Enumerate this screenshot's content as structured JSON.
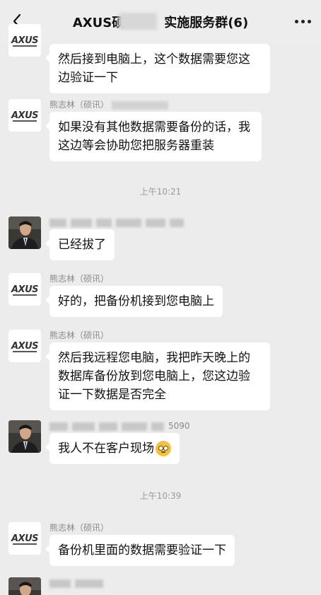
{
  "header": {
    "title_left": "AXUS硕",
    "title_right": "实施服务群(6)"
  },
  "messages": [
    {
      "text": "然后接到电脑上，这个数据需要您这边验证一下"
    },
    {
      "sender": "熊志林（硕讯）",
      "text": "如果没有其他数据需要备份的话，我这边等会协助您把服务器重装"
    },
    {
      "text": "已经拔了"
    },
    {
      "sender": "熊志林（硕讯）",
      "text": "好的，把备份机接到您电脑上"
    },
    {
      "sender": "熊志林（硕讯）",
      "text": "然后我远程您电脑，我把昨天晚上的数据库备份放到您电脑上，您这边验证一下数据是否完全"
    },
    {
      "sender_suffix": "5090",
      "text": "我人不在客户现场"
    },
    {
      "sender": "熊志林（硕讯）",
      "text": "备份机里面的数据需要验证一下"
    }
  ],
  "timestamps": [
    "上午10:21",
    "上午10:39"
  ],
  "avatar_logo": "AXUS",
  "colors": {
    "background": "#ececec",
    "bubble": "#ffffff",
    "meta_text": "#9a9a9a"
  }
}
